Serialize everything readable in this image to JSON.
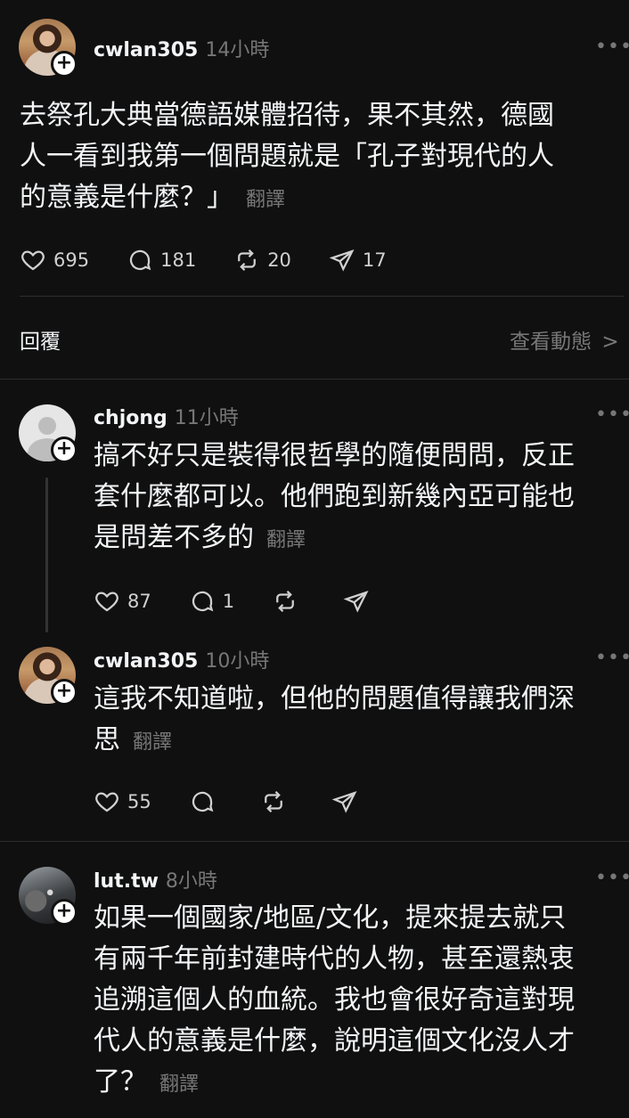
{
  "post": {
    "username": "cwlan305",
    "time": "14小時",
    "lines": [
      "去祭孔大典當德語媒體招待，果不其然，德國",
      "人一看到我第一個問題就是「孔子對現代的人",
      "的意義是什麼？」"
    ],
    "translate": "翻譯",
    "likes": "695",
    "comments": "181",
    "reposts": "20",
    "shares": "17"
  },
  "reply_bar": {
    "replies_label": "回覆",
    "activity_label": "查看動態",
    "chevron": ">"
  },
  "replies": [
    {
      "username": "chjong",
      "time": "11小時",
      "lines": [
        "搞不好只是裝得很哲學的隨便問問，反正",
        "套什麼都可以。他們跑到新幾內亞可能也",
        "是問差不多的"
      ],
      "translate": "翻譯",
      "likes": "87",
      "comments": "1"
    },
    {
      "username": "cwlan305",
      "time": "10小時",
      "lines": [
        "這我不知道啦，但他的問題值得讓我們深",
        "思"
      ],
      "translate": "翻譯",
      "likes": "55"
    },
    {
      "username": "lut.tw",
      "time": "8小時",
      "lines": [
        "如果一個國家/地區/文化，提來提去就只",
        "有兩千年前封建時代的人物，甚至還熱衷",
        "追溯這個人的血統。我也會很好奇這對現",
        "代人的意義是什麼，說明這個文化沒人才",
        "了？"
      ],
      "translate": "翻譯"
    }
  ],
  "more_icon": "•••",
  "follow_icon": "+"
}
